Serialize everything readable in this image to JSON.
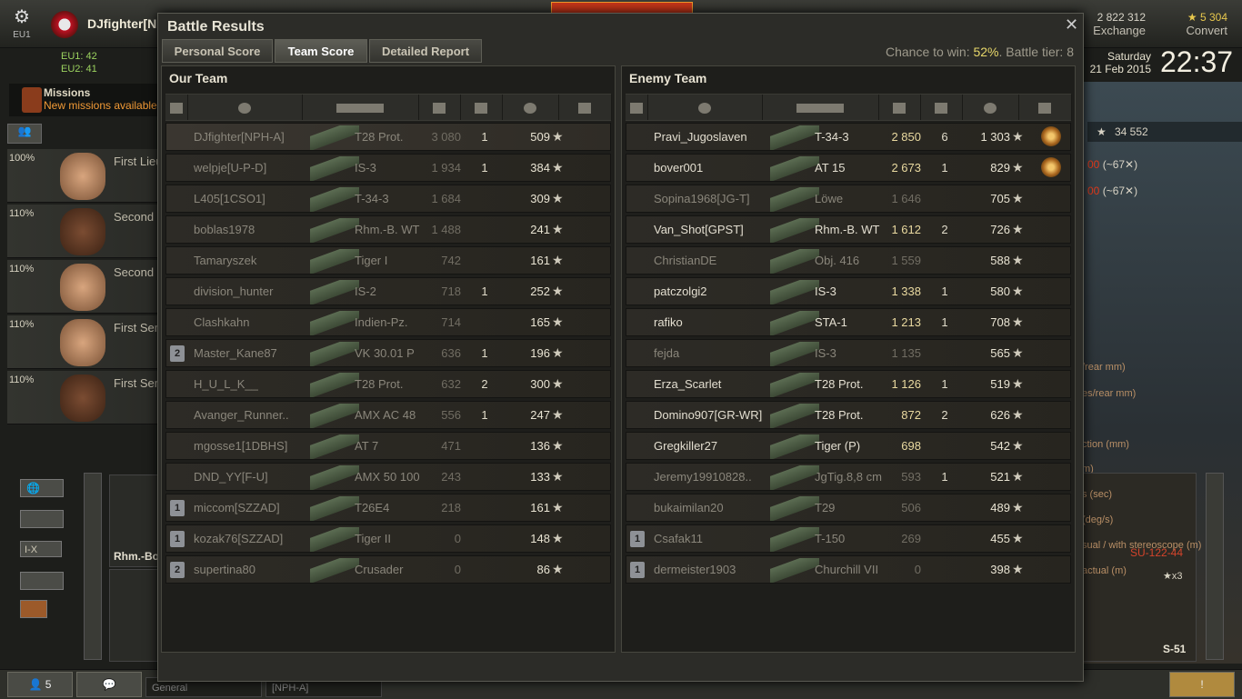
{
  "hangar": {
    "server": "EU1",
    "username": "DJfighter[NPH-A]",
    "online": [
      "EU1: 42",
      "EU2: 41"
    ],
    "credits": "2 822 312",
    "credits_action": "Exchange",
    "gold": "★ 5 304",
    "gold_action": "Convert",
    "day": "Saturday",
    "date": "21 Feb 2015",
    "time": "22:37",
    "missions_title": "Missions",
    "missions_sub": "New missions available",
    "crew": [
      {
        "pct": "100%",
        "role": "First Lieutenant"
      },
      {
        "pct": "110%",
        "role": "Second Lieutenant"
      },
      {
        "pct": "110%",
        "role": "Second Lieutenant"
      },
      {
        "pct": "110%",
        "role": "First Sergeant"
      },
      {
        "pct": "110%",
        "role": "First Sergeant"
      }
    ],
    "tier_filter": "I-X",
    "vehicle_card_1": "Rhm.-Bo",
    "right_stat": "34 552",
    "right_val_1": "(~67✕)",
    "right_val_2": "(~67✕)",
    "right_labels": [
      "/rear mm)",
      "es/rear mm)",
      "ction (mm)",
      "m)",
      "s (sec)",
      "(deg/s)",
      "sual / with stereoscope (m)",
      "actual (m)"
    ],
    "spg_name": "SU-122-44",
    "spg_multiplier": "★x3",
    "spg_label": "S-51",
    "friends_count": "5",
    "chat_channel_1": "General",
    "chat_channel_2": "[NPH-A]"
  },
  "window": {
    "title": "Battle Results",
    "close": "✕",
    "tabs": [
      "Personal Score",
      "Team Score",
      "Detailed Report"
    ],
    "active_tab": "Team Score",
    "chance_label": "Chance to win:",
    "chance_value": "52%",
    "tier_label": ". Battle tier: 8"
  },
  "our_team": {
    "title": "Our Team",
    "rows": [
      {
        "name": "DJfighter[NPH-A]",
        "tank": "T28 Prot.",
        "damage": "3 080",
        "kills": "1",
        "xp": "509",
        "platoon": "",
        "dead": true,
        "me": true
      },
      {
        "name": "welpje[U-P-D]",
        "tank": "IS-3",
        "damage": "1 934",
        "kills": "1",
        "xp": "384",
        "platoon": "",
        "dead": true
      },
      {
        "name": "L405[1CSO1]",
        "tank": "T-34-3",
        "damage": "1 684",
        "kills": "",
        "xp": "309",
        "platoon": "",
        "dead": true
      },
      {
        "name": "boblas1978",
        "tank": "Rhm.-B. WT",
        "damage": "1 488",
        "kills": "",
        "xp": "241",
        "platoon": "",
        "dead": true
      },
      {
        "name": "Tamaryszek",
        "tank": "Tiger I",
        "damage": "742",
        "kills": "",
        "xp": "161",
        "platoon": "",
        "dead": true
      },
      {
        "name": "division_hunter",
        "tank": "IS-2",
        "damage": "718",
        "kills": "1",
        "xp": "252",
        "platoon": "",
        "dead": true
      },
      {
        "name": "Clashkahn",
        "tank": "Indien-Pz.",
        "damage": "714",
        "kills": "",
        "xp": "165",
        "platoon": "",
        "dead": true
      },
      {
        "name": "Master_Kane87",
        "tank": "VK 30.01 P",
        "damage": "636",
        "kills": "1",
        "xp": "196",
        "platoon": "2",
        "dead": true
      },
      {
        "name": "H_U_L_K__",
        "tank": "T28 Prot.",
        "damage": "632",
        "kills": "2",
        "xp": "300",
        "platoon": "",
        "dead": true
      },
      {
        "name": "Avanger_Runner..",
        "tank": "AMX AC 48",
        "damage": "556",
        "kills": "1",
        "xp": "247",
        "platoon": "",
        "dead": true
      },
      {
        "name": "mgosse1[1DBHS]",
        "tank": "AT 7",
        "damage": "471",
        "kills": "",
        "xp": "136",
        "platoon": "",
        "dead": true
      },
      {
        "name": "DND_YY[F-U]",
        "tank": "AMX 50 100",
        "damage": "243",
        "kills": "",
        "xp": "133",
        "platoon": "",
        "dead": true
      },
      {
        "name": "miccom[SZZAD]",
        "tank": "T26E4",
        "damage": "218",
        "kills": "",
        "xp": "161",
        "platoon": "1",
        "dead": true
      },
      {
        "name": "kozak76[SZZAD]",
        "tank": "Tiger II",
        "damage": "0",
        "kills": "",
        "xp": "148",
        "platoon": "1",
        "dead": true
      },
      {
        "name": "supertina80",
        "tank": "Crusader",
        "damage": "0",
        "kills": "",
        "xp": "86",
        "platoon": "2",
        "dead": true
      }
    ]
  },
  "enemy_team": {
    "title": "Enemy Team",
    "rows": [
      {
        "name": "Pravi_Jugoslaven",
        "tank": "T-34-3",
        "damage": "2 850",
        "kills": "6",
        "xp": "1 303",
        "platoon": "",
        "dead": false,
        "medal": true
      },
      {
        "name": "bover001",
        "tank": "AT 15",
        "damage": "2 673",
        "kills": "1",
        "xp": "829",
        "platoon": "",
        "dead": false,
        "medal": true
      },
      {
        "name": "Sopina1968[JG-T]",
        "tank": "Löwe",
        "damage": "1 646",
        "kills": "",
        "xp": "705",
        "platoon": "",
        "dead": true
      },
      {
        "name": "Van_Shot[GPST]",
        "tank": "Rhm.-B. WT",
        "damage": "1 612",
        "kills": "2",
        "xp": "726",
        "platoon": "",
        "dead": false
      },
      {
        "name": "ChristianDE",
        "tank": "Obj. 416",
        "damage": "1 559",
        "kills": "",
        "xp": "588",
        "platoon": "",
        "dead": true
      },
      {
        "name": "patczolgi2",
        "tank": "IS-3",
        "damage": "1 338",
        "kills": "1",
        "xp": "580",
        "platoon": "",
        "dead": false
      },
      {
        "name": "rafiko",
        "tank": "STA-1",
        "damage": "1 213",
        "kills": "1",
        "xp": "708",
        "platoon": "",
        "dead": false
      },
      {
        "name": "fejda",
        "tank": "IS-3",
        "damage": "1 135",
        "kills": "",
        "xp": "565",
        "platoon": "",
        "dead": true
      },
      {
        "name": "Erza_Scarlet",
        "tank": "T28 Prot.",
        "damage": "1 126",
        "kills": "1",
        "xp": "519",
        "platoon": "",
        "dead": false
      },
      {
        "name": "Domino907[GR-WR]",
        "tank": "T28 Prot.",
        "damage": "872",
        "kills": "2",
        "xp": "626",
        "platoon": "",
        "dead": false
      },
      {
        "name": "Gregkiller27",
        "tank": "Tiger (P)",
        "damage": "698",
        "kills": "",
        "xp": "542",
        "platoon": "",
        "dead": false
      },
      {
        "name": "Jeremy19910828..",
        "tank": "JgTig.8,8 cm",
        "damage": "593",
        "kills": "1",
        "xp": "521",
        "platoon": "",
        "dead": true
      },
      {
        "name": "bukaimilan20",
        "tank": "T29",
        "damage": "506",
        "kills": "",
        "xp": "489",
        "platoon": "",
        "dead": true
      },
      {
        "name": "Csafak11",
        "tank": "T-150",
        "damage": "269",
        "kills": "",
        "xp": "455",
        "platoon": "1",
        "dead": true
      },
      {
        "name": "dermeister1903",
        "tank": "Churchill VII",
        "damage": "0",
        "kills": "",
        "xp": "398",
        "platoon": "1",
        "dead": true
      }
    ]
  }
}
